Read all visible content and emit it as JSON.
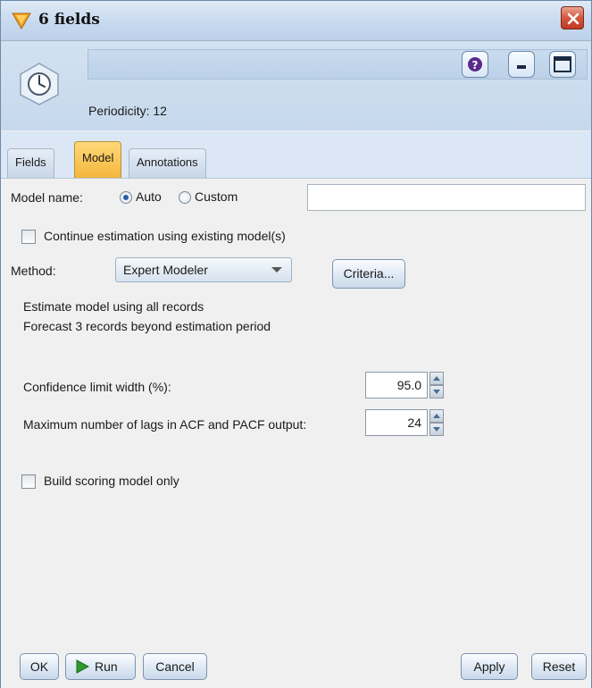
{
  "window": {
    "title": "6 fields"
  },
  "header": {
    "periodicity": "Periodicity: 12",
    "name_value": ""
  },
  "tabs": [
    {
      "label": "Fields",
      "active": false
    },
    {
      "label": "Model",
      "active": true
    },
    {
      "label": "Annotations",
      "active": false
    }
  ],
  "model": {
    "model_name_label": "Model name:",
    "auto_label": "Auto",
    "custom_label": "Custom",
    "model_name_mode": "Auto",
    "custom_value": "",
    "continue_label": "Continue estimation using existing model(s)",
    "continue_checked": false,
    "method_label": "Method:",
    "method_value": "Expert Modeler",
    "criteria_label": "Criteria...",
    "info_line1": "Estimate model using all records",
    "info_line2": "Forecast 3 records beyond estimation period",
    "confidence_label": "Confidence limit width (%):",
    "confidence_value": "95.0",
    "lags_label": "Maximum number of lags in ACF and PACF output:",
    "lags_value": "24",
    "scoring_label": "Build scoring model only",
    "scoring_checked": false
  },
  "footer": {
    "ok": "OK",
    "run": "Run",
    "cancel": "Cancel",
    "apply": "Apply",
    "reset": "Reset"
  },
  "colors": {
    "active_tab": "#f4b63c",
    "titlebar": "#c7d9ee",
    "close": "#d4553c",
    "run_icon": "#2e9a2e",
    "help_icon": "#5a2a8a"
  }
}
